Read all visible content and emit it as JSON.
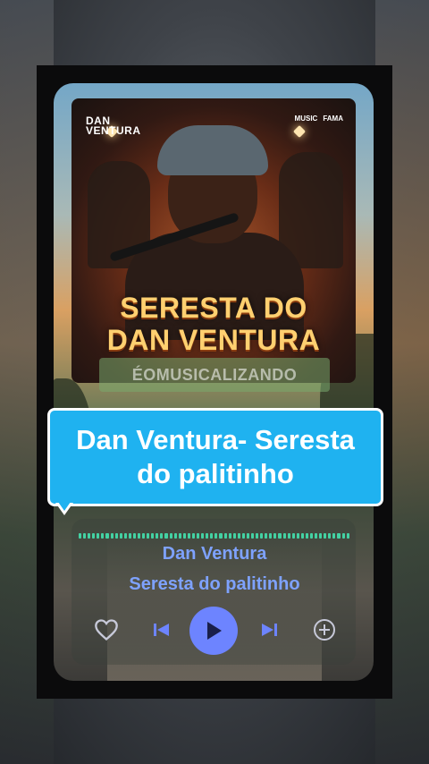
{
  "cover": {
    "logo_left_line1": "DAN",
    "logo_left_line2": "VENTURA",
    "logo_right_1": "MUSIC",
    "logo_right_2": "FAMA",
    "title_line1": "SERESTA DO",
    "title_line2": "DAN VENTURA"
  },
  "watermark": {
    "text": "ÉOMUSICALIZANDO"
  },
  "caption": {
    "line1": "Dan Ventura- Seresta",
    "line2": "do palitinho"
  },
  "player": {
    "artist": "Dan Ventura",
    "song": "Seresta do palitinho",
    "progress_fraction": 1.0,
    "accent_color": "#6d84ff",
    "progress_color": "#43d2a3",
    "controls": [
      "heart-icon",
      "previous-icon",
      "play-icon",
      "next-icon",
      "add-icon"
    ]
  }
}
